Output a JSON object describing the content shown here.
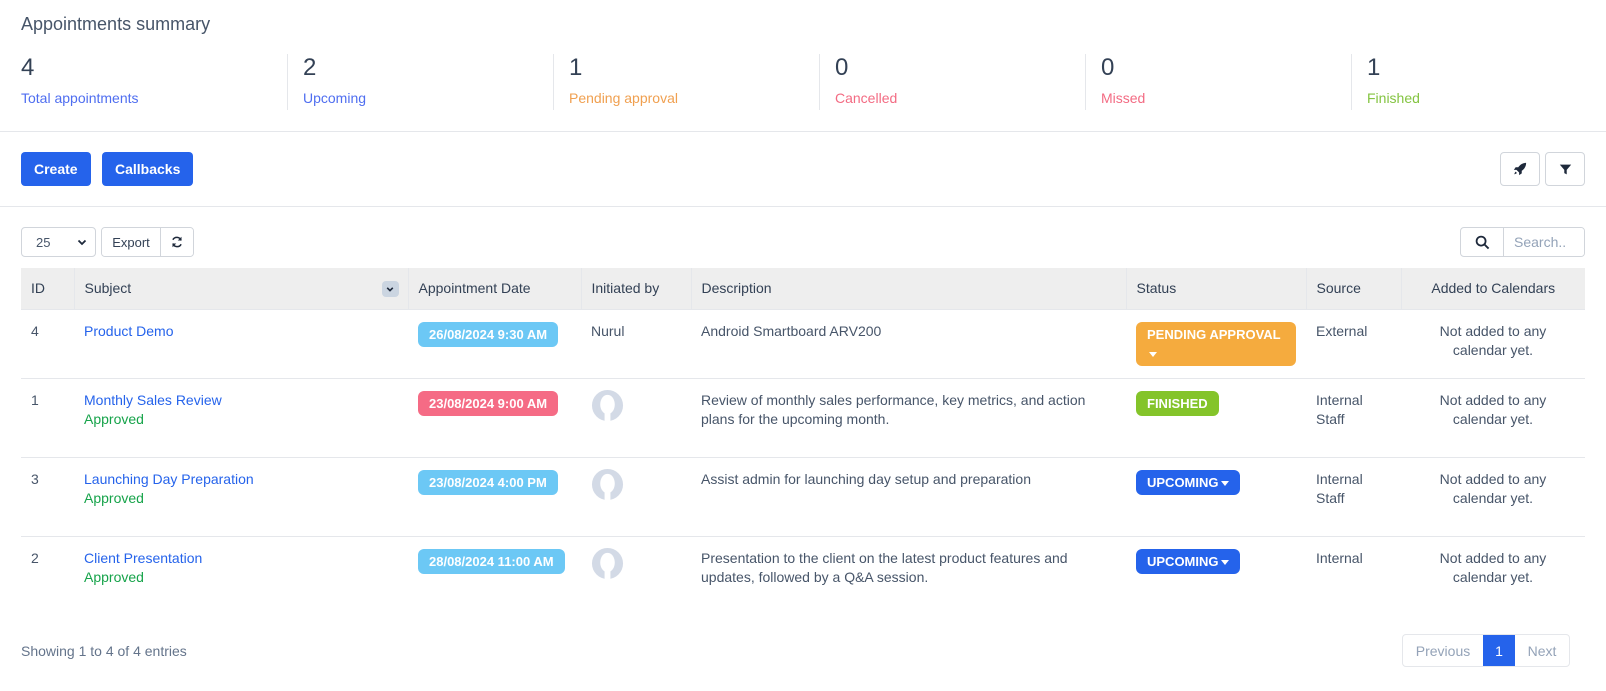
{
  "summary": {
    "title": "Appointments summary",
    "stats": [
      {
        "value": "4",
        "label": "Total appointments",
        "color": "#4f6ef0"
      },
      {
        "value": "2",
        "label": "Upcoming",
        "color": "#4f6ef0"
      },
      {
        "value": "1",
        "label": "Pending approval",
        "color": "#f0a050"
      },
      {
        "value": "0",
        "label": "Cancelled",
        "color": "#f36b83"
      },
      {
        "value": "0",
        "label": "Missed",
        "color": "#f36b83"
      },
      {
        "value": "1",
        "label": "Finished",
        "color": "#84c441"
      }
    ]
  },
  "toolbar": {
    "create_label": "Create",
    "callbacks_label": "Callbacks",
    "rocket_icon": "rocket-icon",
    "filter_icon": "filter-icon"
  },
  "table_controls": {
    "page_length": "25",
    "export_label": "Export",
    "reload_icon": "refresh-icon",
    "search_placeholder": "Search.."
  },
  "table": {
    "columns": [
      "ID",
      "Subject",
      "Appointment Date",
      "Initiated by",
      "Description",
      "Status",
      "Source",
      "Added to Calendars"
    ],
    "rows": [
      {
        "id": "4",
        "subject": "Product Demo",
        "approval": "",
        "date": "26/08/2024 9:30 AM",
        "date_color": "#6cc8f5",
        "initiated_by": "Nurul",
        "description": "Android Smartboard ARV200",
        "status": "PENDING APPROVAL",
        "status_color": "#f5ab3e",
        "status_dropdown": true,
        "source": "External",
        "calendar": "Not added to any calendar yet."
      },
      {
        "id": "1",
        "subject": "Monthly Sales Review",
        "approval": "Approved",
        "date": "23/08/2024 9:00 AM",
        "date_color": "#f56b85",
        "initiated_by": "",
        "description": "Review of monthly sales performance, key metrics, and action plans for the upcoming month.",
        "status": "FINISHED",
        "status_color": "#84c42a",
        "status_dropdown": false,
        "source": "Internal Staff",
        "calendar": "Not added to any calendar yet."
      },
      {
        "id": "3",
        "subject": "Launching Day Preparation",
        "approval": "Approved",
        "date": "23/08/2024 4:00 PM",
        "date_color": "#6cc8f5",
        "initiated_by": "",
        "description": "Assist admin for launching day setup and preparation",
        "status": "UPCOMING",
        "status_color": "#2563eb",
        "status_dropdown": true,
        "source": "Internal Staff",
        "calendar": "Not added to any calendar yet."
      },
      {
        "id": "2",
        "subject": "Client Presentation",
        "approval": "Approved",
        "date": "28/08/2024 11:00 AM",
        "date_color": "#6cc8f5",
        "initiated_by": "",
        "description": "Presentation to the client on the latest product features and updates, followed by a Q&A session.",
        "status": "UPCOMING",
        "status_color": "#2563eb",
        "status_dropdown": true,
        "source": "Internal",
        "calendar": "Not added to any calendar yet."
      }
    ]
  },
  "footer": {
    "info": "Showing 1 to 4 of 4 entries",
    "prev_label": "Previous",
    "current_page": "1",
    "next_label": "Next"
  }
}
